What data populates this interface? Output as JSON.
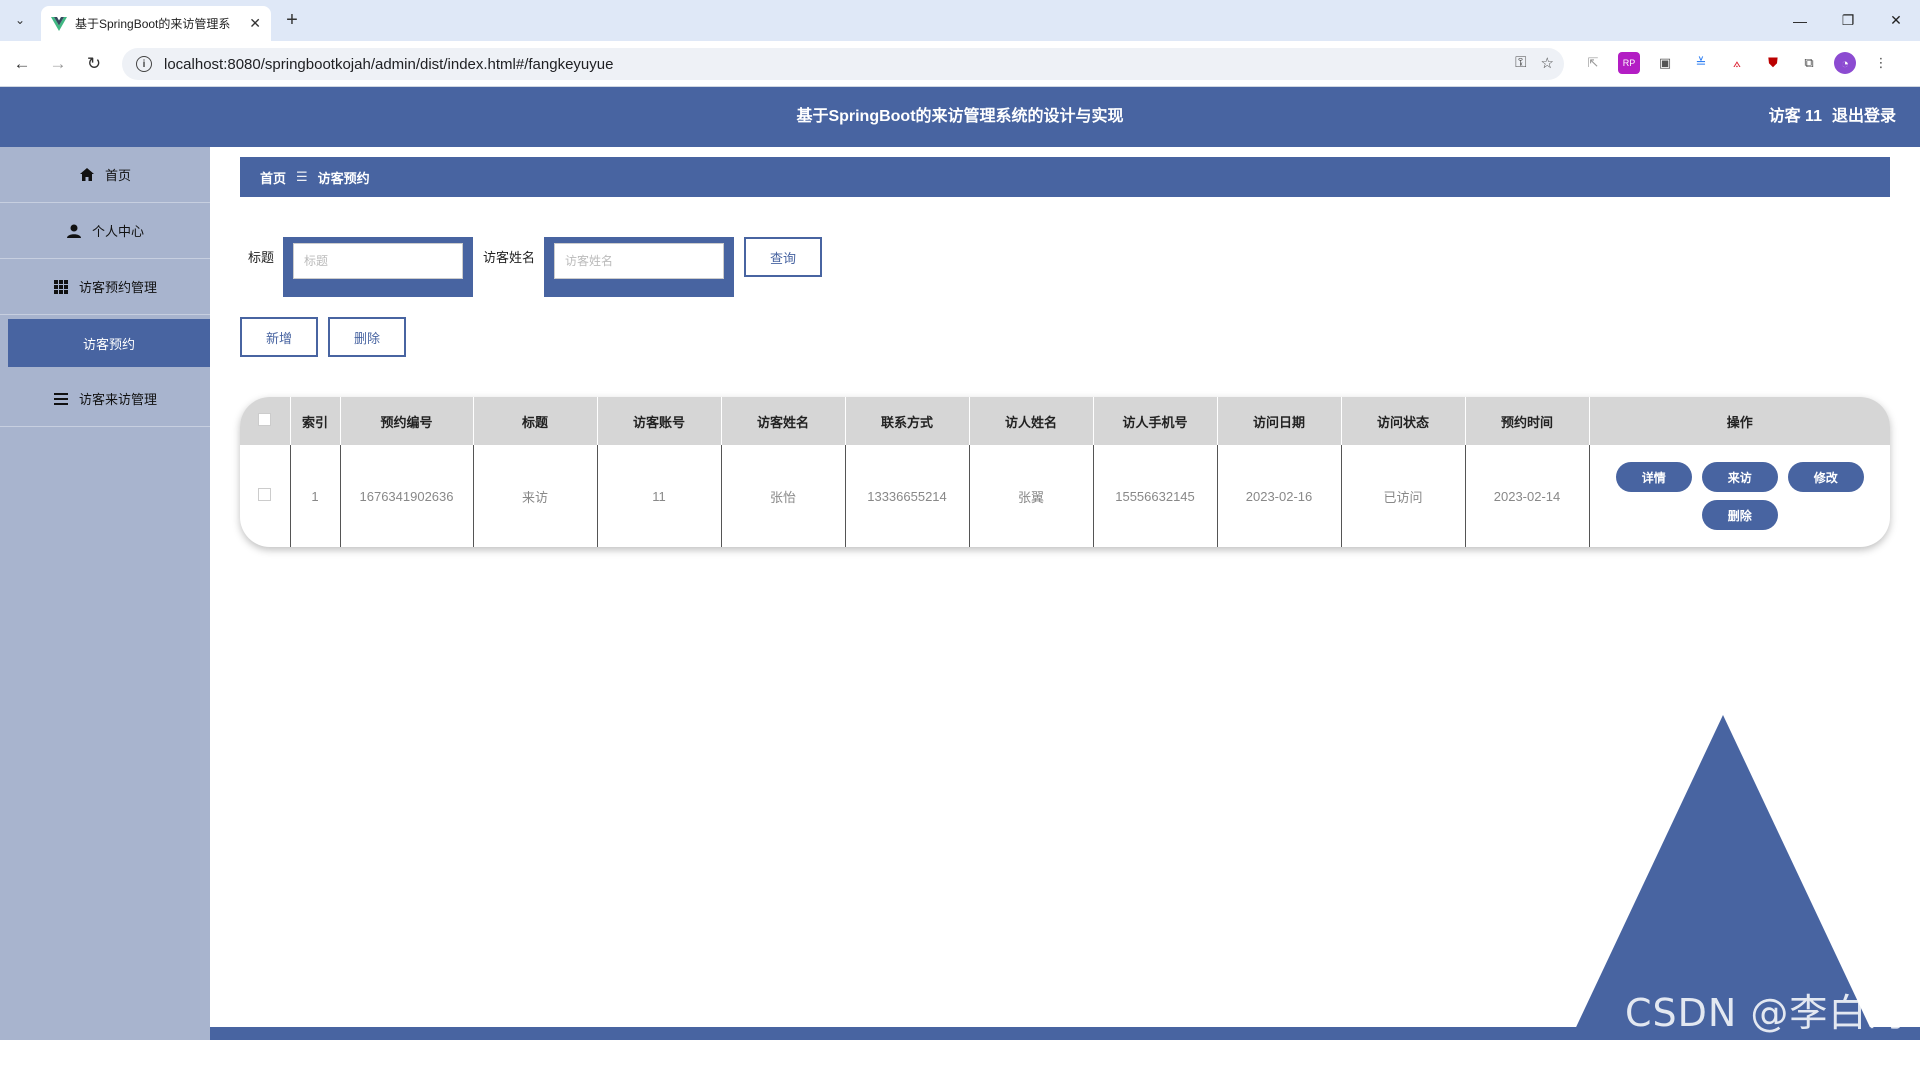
{
  "browser": {
    "tab_title": "基于SpringBoot的来访管理系",
    "url": "localhost:8080/springbootkojah/admin/dist/index.html#/fangkeyuyue"
  },
  "header": {
    "title": "基于SpringBoot的来访管理系统的设计与实现",
    "user_label": "访客 11",
    "logout": "退出登录"
  },
  "sidebar": {
    "items": [
      {
        "label": "首页",
        "icon": "home-icon"
      },
      {
        "label": "个人中心",
        "icon": "user-icon"
      },
      {
        "label": "访客预约管理",
        "icon": "grid-icon"
      },
      {
        "label": "访客预约",
        "icon": ""
      },
      {
        "label": "访客来访管理",
        "icon": "list-icon"
      }
    ]
  },
  "breadcrumb": {
    "home": "首页",
    "separator": "☰",
    "current": "访客预约"
  },
  "search": {
    "title_label": "标题",
    "title_placeholder": "标题",
    "name_label": "访客姓名",
    "name_placeholder": "访客姓名",
    "query_button": "查询"
  },
  "actions": {
    "add": "新增",
    "delete": "删除"
  },
  "table": {
    "columns": [
      "索引",
      "预约编号",
      "标题",
      "访客账号",
      "访客姓名",
      "联系方式",
      "访人姓名",
      "访人手机号",
      "访问日期",
      "访问状态",
      "预约时间",
      "操作"
    ],
    "rows": [
      {
        "index": "1",
        "booking_no": "1676341902636",
        "title": "来访",
        "account": "11",
        "visitor_name": "张怡",
        "contact": "13336655214",
        "host_name": "张翼",
        "host_phone": "15556632145",
        "visit_date": "2023-02-16",
        "status": "已访问",
        "booking_time": "2023-02-14"
      }
    ],
    "ops": {
      "detail": "详情",
      "visit": "来访",
      "edit": "修改",
      "delete": "删除"
    }
  },
  "watermark": "CSDN @李白的粉",
  "colors": {
    "primary": "#4864a1",
    "sidebar": "#a8b4ce"
  }
}
